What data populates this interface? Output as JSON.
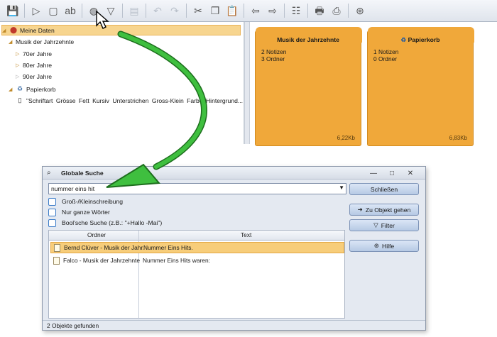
{
  "toolbar": {
    "buttons": [
      {
        "name": "save-icon",
        "glyph": "💾",
        "enabled": false
      },
      {
        "name": "new-note-icon",
        "glyph": "▷",
        "enabled": true
      },
      {
        "name": "new-folder-icon",
        "glyph": "▢",
        "enabled": true
      },
      {
        "name": "rename-icon",
        "glyph": "ab",
        "enabled": true
      },
      {
        "name": "search-icon",
        "glyph": "◍",
        "enabled": true
      },
      {
        "name": "filter-icon",
        "glyph": "▽",
        "enabled": true
      },
      {
        "name": "print-preview-icon",
        "glyph": "▤",
        "enabled": false
      },
      {
        "name": "undo-icon",
        "glyph": "↶",
        "enabled": false
      },
      {
        "name": "redo-icon",
        "glyph": "↷",
        "enabled": false
      },
      {
        "name": "cut-icon",
        "glyph": "✂",
        "enabled": true
      },
      {
        "name": "copy-icon",
        "glyph": "❐",
        "enabled": true
      },
      {
        "name": "paste-icon",
        "glyph": "📋",
        "enabled": true
      },
      {
        "name": "back-icon",
        "glyph": "⇦",
        "enabled": true
      },
      {
        "name": "forward-icon",
        "glyph": "⇨",
        "enabled": true
      },
      {
        "name": "settings-icon",
        "glyph": "☷",
        "enabled": true
      },
      {
        "name": "print-icon",
        "glyph": "🖶",
        "enabled": true
      },
      {
        "name": "export-icon",
        "glyph": "⎙",
        "enabled": true
      },
      {
        "name": "help-icon",
        "glyph": "⊛",
        "enabled": true
      }
    ]
  },
  "tree": {
    "root": "Meine Daten",
    "decades_folder": "Musik der Jahrzehnte",
    "decades": [
      "70er Jahre",
      "80er Jahre",
      "90er Jahre"
    ],
    "trash": "Papierkorb",
    "trash_note": "\"Schriftart Grösse Fett Kursiv Unterstrichen Gross-Klein Farbe Hintergrund..."
  },
  "tiles": [
    {
      "title": "Musik der Jahrzehnte",
      "line1": "2 Notizen",
      "line2": "3 Ordner",
      "size": "6,22Kb"
    },
    {
      "title": "Papierkorb",
      "line1": "1 Notizen",
      "line2": "0 Ordner",
      "size": "6,83Kb"
    }
  ],
  "dialog": {
    "title": "Globale Suche",
    "search_value": "nummer eins hit",
    "options": [
      "Groß-/Kleinschreibung",
      "Nur ganze Wörter",
      "Bool'sche Suche (z.B.: \"+Hallo -Mai\")"
    ],
    "columns": [
      "Ordner",
      "Text"
    ],
    "results": [
      {
        "folder": "Bernd Clüver - Musik der Jahr...",
        "text": "Nummer Eins Hits."
      },
      {
        "folder": "Falco - Musik der Jahrzehnte",
        "text": "Nummer Eins Hits waren:"
      }
    ],
    "buttons": {
      "close": "Schließen",
      "goto": "Zu Objekt gehen",
      "filter": "Filter",
      "help": "Hilfe"
    },
    "status": "2 Objekte gefunden",
    "win": {
      "min": "—",
      "max": "□",
      "close": "✕"
    }
  },
  "colors": {
    "tile": "#f0a83a",
    "selection": "#f7cd7a",
    "arrow": "#2e9a2e"
  }
}
